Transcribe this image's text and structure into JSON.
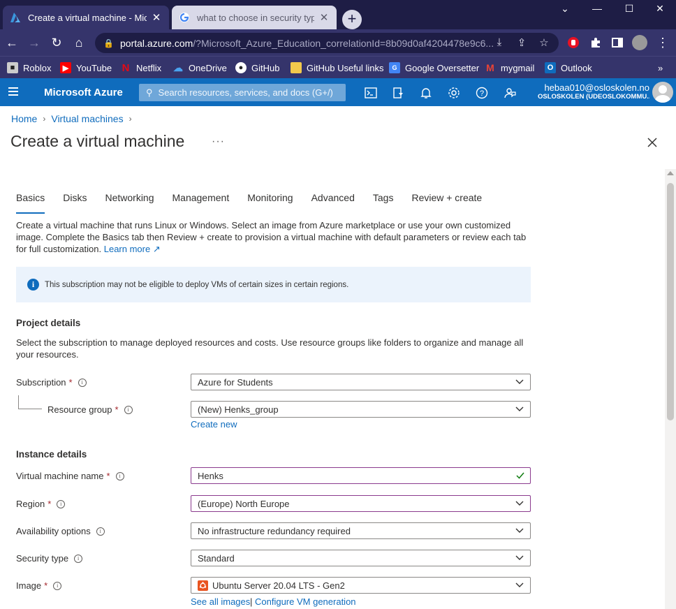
{
  "browser": {
    "tabs": [
      {
        "title": "Create a virtual machine - Micros",
        "active": true
      },
      {
        "title": "what to choose in security type a",
        "active": false
      }
    ],
    "url_host": "portal.azure.com",
    "url_path": "/?Microsoft_Azure_Education_correlationId=8b09d0af4204478e9c6...",
    "bookmarks": [
      "Roblox",
      "YouTube",
      "Netflix",
      "OneDrive",
      "GitHub",
      "GitHub Useful links",
      "Google Oversetter",
      "mygmail",
      "Outlook"
    ],
    "bookmarks_more": "»"
  },
  "azure": {
    "brand": "Microsoft Azure",
    "search_placeholder": "Search resources, services, and docs (G+/)",
    "user_email": "hebaa010@osloskolen.no",
    "user_org": "OSLOSKOLEN (UDEOSLOKOMMU...",
    "header_color": "#0f6cbd"
  },
  "page": {
    "breadcrumb": [
      "Home",
      "Virtual machines"
    ],
    "title": "Create a virtual machine",
    "more": "···",
    "tabs": [
      "Basics",
      "Disks",
      "Networking",
      "Management",
      "Monitoring",
      "Advanced",
      "Tags",
      "Review + create"
    ],
    "active_tab": "Basics",
    "intro": "Create a virtual machine that runs Linux or Windows. Select an image from Azure marketplace or use your own customized image. Complete the Basics tab then Review + create to provision a virtual machine with default parameters or review each tab for full customization.",
    "learn_more": "Learn more",
    "info_banner": "This subscription may not be eligible to deploy VMs of certain sizes in certain regions.",
    "project": {
      "heading": "Project details",
      "description": "Select the subscription to manage deployed resources and costs. Use resource groups like folders to organize and manage all your resources.",
      "subscription_label": "Subscription",
      "subscription_value": "Azure for Students",
      "resource_group_label": "Resource group",
      "resource_group_value": "(New) Henks_group",
      "create_new": "Create new"
    },
    "instance": {
      "heading": "Instance details",
      "vm_name_label": "Virtual machine name",
      "vm_name_value": "Henks",
      "region_label": "Region",
      "region_value": "(Europe) North Europe",
      "availability_label": "Availability options",
      "availability_value": "No infrastructure redundancy required",
      "security_label": "Security type",
      "security_value": "Standard",
      "image_label": "Image",
      "image_value": "Ubuntu Server 20.04 LTS - Gen2",
      "see_all_images": "See all images",
      "configure_vm_generation": "Configure VM generation",
      "link_separator": "|"
    },
    "required_mark": "*"
  }
}
